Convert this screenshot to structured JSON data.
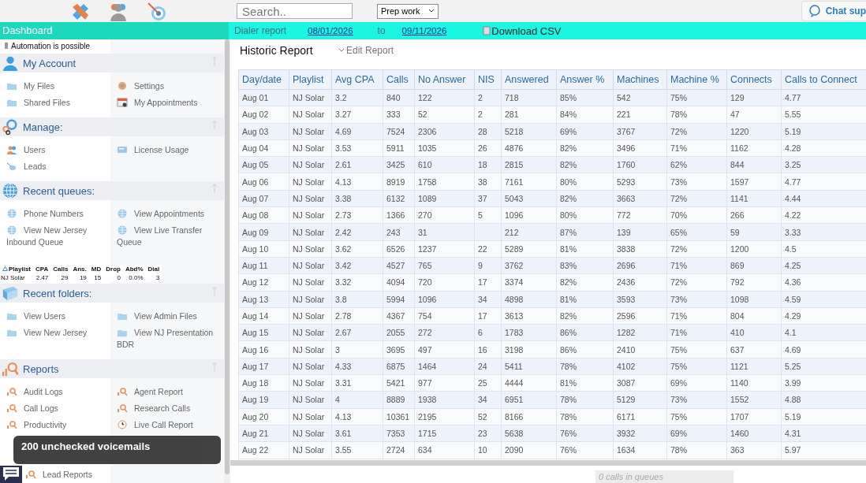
{
  "topbar": {
    "search": {
      "placeholder": "Search.."
    },
    "select": {
      "value": "Prep work"
    },
    "chat_button": "Chat sup"
  },
  "sidebar": {
    "title": "Dashboard",
    "note": "Automation is possible",
    "sections": [
      {
        "kind": "links",
        "title": "My Account",
        "items": [
          {
            "label": "My Files"
          },
          {
            "label": "Settings"
          },
          {
            "label": "Shared Files"
          },
          {
            "label": "My Appointments"
          }
        ]
      },
      {
        "kind": "links",
        "title": "Manage:",
        "items": [
          {
            "label": "Users"
          },
          {
            "label": "License Usage"
          },
          {
            "label": "Leads"
          }
        ]
      },
      {
        "kind": "links",
        "title": "Recent queues:",
        "items": [
          {
            "label": "Phone Numbers"
          },
          {
            "label": "View Appointments"
          },
          {
            "label": "View New Jersey Inbound Queue"
          },
          {
            "label": "View Live Transfer Queue"
          }
        ]
      },
      {
        "kind": "stats",
        "columns": [
          "Playlist",
          "CPA",
          "Calls",
          "Ans.",
          "MD",
          "Drop",
          "Abd%",
          "Dial"
        ],
        "rows": [
          [
            "NJ Solar",
            "2.47",
            "29",
            "19",
            "15",
            "0",
            "0.0%",
            "3"
          ]
        ]
      },
      {
        "kind": "links",
        "title": "Recent folders:",
        "items": [
          {
            "label": "View Users"
          },
          {
            "label": "View Admin Files"
          },
          {
            "label": "View New Jersey"
          },
          {
            "label": "View NJ Presentation BDR"
          }
        ]
      },
      {
        "kind": "links",
        "title": "Reports",
        "items": [
          {
            "label": "Audit Logs"
          },
          {
            "label": "Agent Report"
          },
          {
            "label": "Call Logs"
          },
          {
            "label": "Research Calls"
          },
          {
            "label": "Productivity"
          },
          {
            "label": "Live Call Report"
          },
          {
            "label": "Lead Reports"
          }
        ]
      }
    ]
  },
  "toast": "200 unchecked voicemails",
  "dialer": {
    "title": "Dialer report",
    "from": "08/01/2026",
    "to_label": "to",
    "to": "09/11/2026",
    "download": "Download CSV"
  },
  "report": {
    "title": "Historic Report",
    "edit": "Edit Report",
    "columns": [
      "Day/date",
      "Playlist",
      "Avg CPA",
      "Calls",
      "No Answer",
      "NIS",
      "Answered",
      "Answer %",
      "Machines",
      "Machine %",
      "Connects",
      "Calls to Connect"
    ],
    "rows": [
      [
        "Aug 01",
        "NJ Solar",
        "3.2",
        "840",
        "122",
        "2",
        "718",
        "85%",
        "542",
        "75%",
        "129",
        "4.77"
      ],
      [
        "Aug 02",
        "NJ Solar",
        "3.27",
        "333",
        "52",
        "2",
        "281",
        "84%",
        "221",
        "78%",
        "47",
        "5.55"
      ],
      [
        "Aug 03",
        "NJ Solar",
        "4.69",
        "7524",
        "2306",
        "28",
        "5218",
        "69%",
        "3767",
        "72%",
        "1220",
        "5.19"
      ],
      [
        "Aug 04",
        "NJ Solar",
        "3.53",
        "5911",
        "1035",
        "26",
        "4876",
        "82%",
        "3496",
        "71%",
        "1162",
        "4.28"
      ],
      [
        "Aug 05",
        "NJ Solar",
        "2.61",
        "3425",
        "610",
        "18",
        "2815",
        "82%",
        "1760",
        "62%",
        "844",
        "3.25"
      ],
      [
        "Aug 06",
        "NJ Solar",
        "4.13",
        "8919",
        "1758",
        "38",
        "7161",
        "80%",
        "5293",
        "73%",
        "1597",
        "4.77"
      ],
      [
        "Aug 07",
        "NJ Solar",
        "3.38",
        "6132",
        "1089",
        "37",
        "5043",
        "82%",
        "3663",
        "72%",
        "1141",
        "4.44"
      ],
      [
        "Aug 08",
        "NJ Solar",
        "2.73",
        "1366",
        "270",
        "5",
        "1096",
        "80%",
        "772",
        "70%",
        "266",
        "4.22"
      ],
      [
        "Aug 09",
        "NJ Solar",
        "2.42",
        "243",
        "31",
        null,
        "212",
        "87%",
        "139",
        "65%",
        "59",
        "3.33"
      ],
      [
        "Aug 10",
        "NJ Solar",
        "3.62",
        "6526",
        "1237",
        "22",
        "5289",
        "81%",
        "3838",
        "72%",
        "1200",
        "4.5"
      ],
      [
        "Aug 11",
        "NJ Solar",
        "3.42",
        "4527",
        "765",
        "9",
        "3762",
        "83%",
        "2696",
        "71%",
        "869",
        "4.25"
      ],
      [
        "Aug 12",
        "NJ Solar",
        "3.32",
        "4094",
        "720",
        "17",
        "3374",
        "82%",
        "2436",
        "72%",
        "792",
        "4.36"
      ],
      [
        "Aug 13",
        "NJ Solar",
        "3.8",
        "5994",
        "1096",
        "34",
        "4898",
        "81%",
        "3593",
        "73%",
        "1098",
        "4.59"
      ],
      [
        "Aug 14",
        "NJ Solar",
        "2.78",
        "4367",
        "754",
        "17",
        "3613",
        "82%",
        "2596",
        "71%",
        "804",
        "4.29"
      ],
      [
        "Aug 15",
        "NJ Solar",
        "2.67",
        "2055",
        "272",
        "6",
        "1783",
        "86%",
        "1282",
        "71%",
        "410",
        "4.1"
      ],
      [
        "Aug 16",
        "NJ Solar",
        "3",
        "3695",
        "497",
        "16",
        "3198",
        "86%",
        "2410",
        "75%",
        "637",
        "4.69"
      ],
      [
        "Aug 17",
        "NJ Solar",
        "4.33",
        "6875",
        "1464",
        "24",
        "5411",
        "78%",
        "4102",
        "75%",
        "1121",
        "5.25"
      ],
      [
        "Aug 18",
        "NJ Solar",
        "3.31",
        "5421",
        "977",
        "25",
        "4444",
        "81%",
        "3087",
        "69%",
        "1140",
        "3.99"
      ],
      [
        "Aug 19",
        "NJ Solar",
        "4",
        "8889",
        "1938",
        "34",
        "6951",
        "78%",
        "5129",
        "73%",
        "1552",
        "4.88"
      ],
      [
        "Aug 20",
        "NJ Solar",
        "4.13",
        "10361",
        "2195",
        "52",
        "8166",
        "78%",
        "6171",
        "75%",
        "1707",
        "5.19"
      ],
      [
        "Aug 21",
        "NJ Solar",
        "3.61",
        "7353",
        "1715",
        "23",
        "5638",
        "76%",
        "3932",
        "69%",
        "1460",
        "4.31"
      ],
      [
        "Aug 22",
        "NJ Solar",
        "3.55",
        "2724",
        "634",
        "10",
        "2090",
        "76%",
        "1634",
        "78%",
        "363",
        "5.97"
      ]
    ]
  },
  "queue_status": "0 calls in queues"
}
